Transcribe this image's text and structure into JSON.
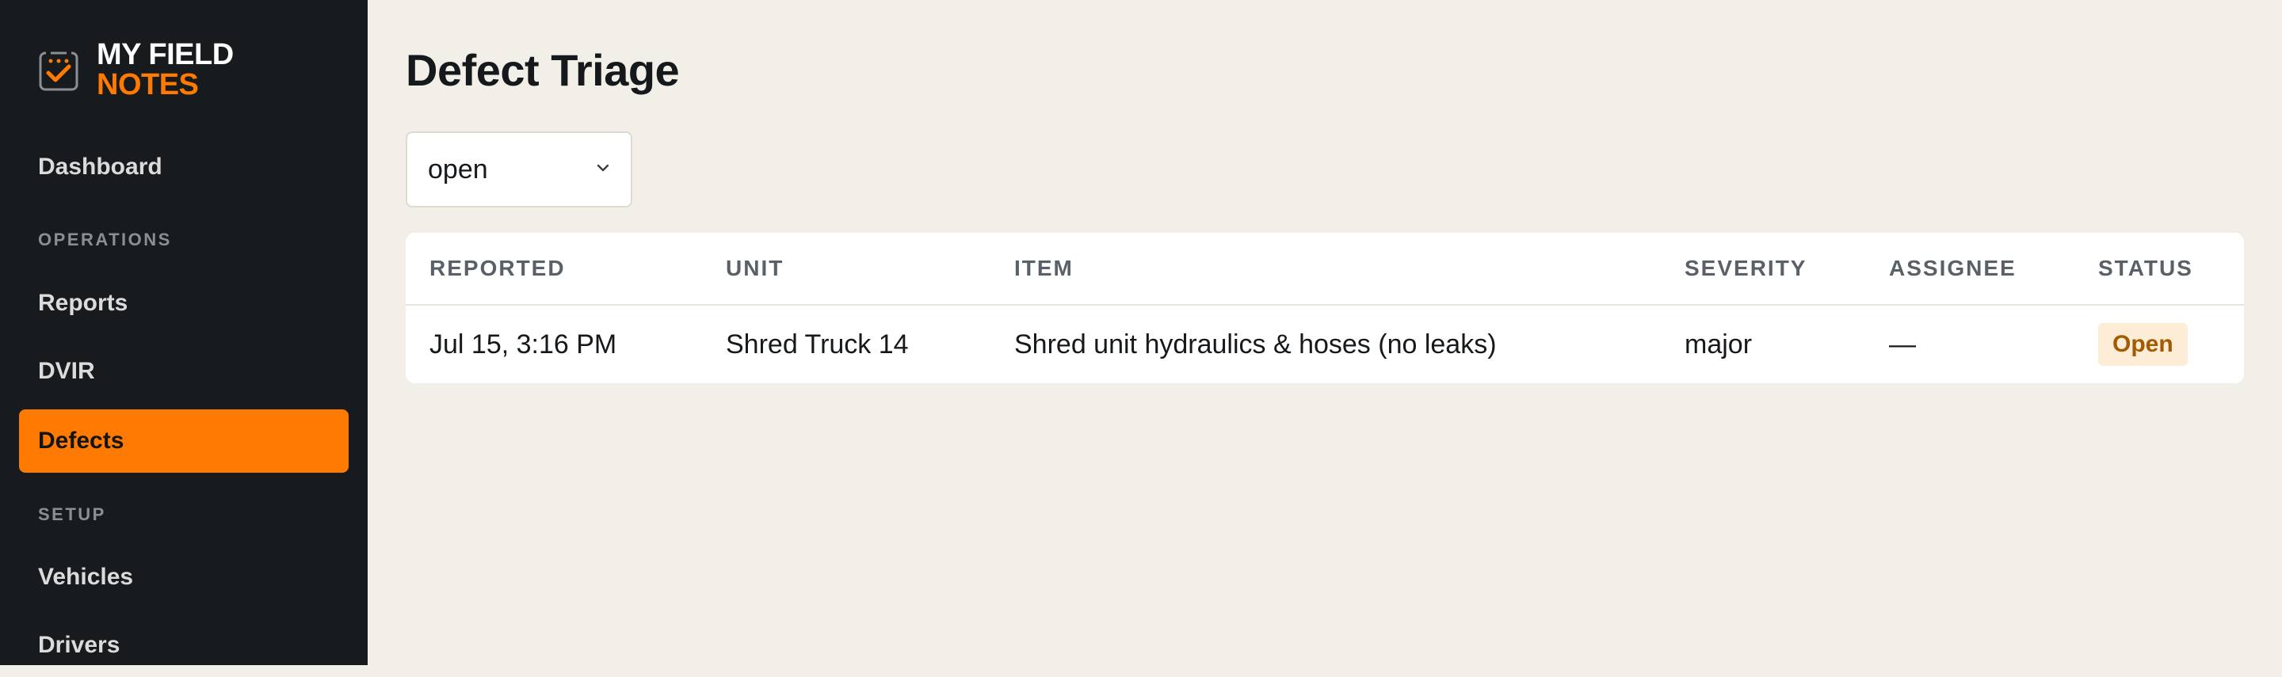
{
  "brand": {
    "line1": "MY FIELD",
    "line2": "NOTES",
    "accent": "#ff7a00"
  },
  "sidebar": {
    "items": [
      {
        "label": "Dashboard"
      },
      {
        "section": "OPERATIONS"
      },
      {
        "label": "Reports"
      },
      {
        "label": "DVIR"
      },
      {
        "label": "Defects",
        "active": true
      },
      {
        "section": "SETUP"
      },
      {
        "label": "Vehicles"
      },
      {
        "label": "Drivers"
      }
    ]
  },
  "page": {
    "title": "Defect Triage"
  },
  "filter": {
    "value": "open",
    "icon": "chevron-down-icon"
  },
  "table": {
    "columns": [
      "REPORTED",
      "UNIT",
      "ITEM",
      "SEVERITY",
      "ASSIGNEE",
      "STATUS"
    ],
    "rows": [
      {
        "reported": "Jul 15, 3:16 PM",
        "unit": "Shred Truck 14",
        "item": "Shred unit hydraulics & hoses (no leaks)",
        "severity": "major",
        "assignee": "—",
        "status": "Open"
      }
    ]
  },
  "colors": {
    "sidebar_bg": "#181b1e",
    "page_bg": "#f2efe9",
    "status_open_bg": "#fdecd6",
    "status_open_text": "#a35a00"
  }
}
